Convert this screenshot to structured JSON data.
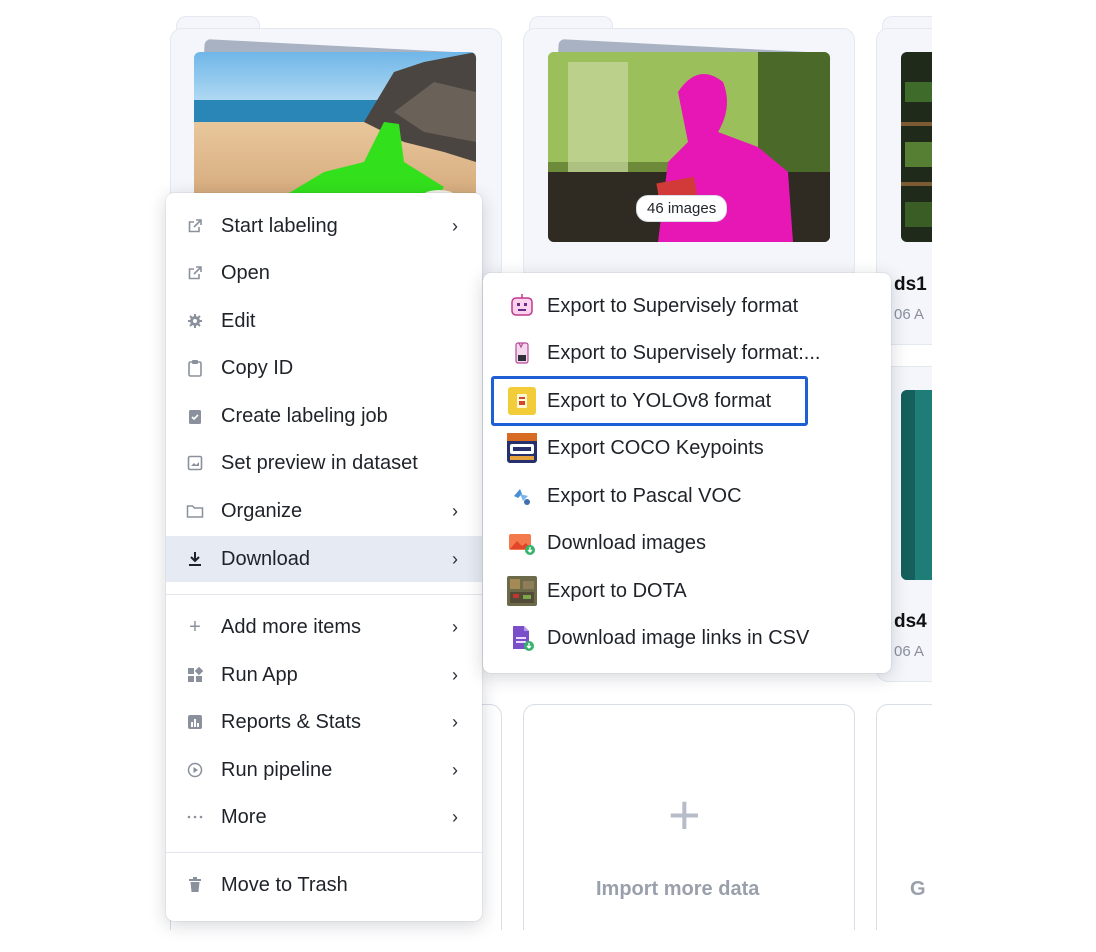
{
  "cards": {
    "card1_badge": "46 images",
    "ds1_name": "ds1",
    "ds1_date": "06 A",
    "ds4_name": "ds4",
    "ds4_date": "06 A",
    "import_label": "Import more data",
    "partial_label": "G"
  },
  "menu": {
    "items": [
      {
        "label": "Start labeling",
        "icon": "external-link-icon",
        "has_submenu": true
      },
      {
        "label": "Open",
        "icon": "external-link-icon",
        "has_submenu": false
      },
      {
        "label": "Edit",
        "icon": "gear-icon",
        "has_submenu": false
      },
      {
        "label": "Copy ID",
        "icon": "clipboard-icon",
        "has_submenu": false
      },
      {
        "label": "Create labeling job",
        "icon": "clipboard-check-icon",
        "has_submenu": false
      },
      {
        "label": "Set preview in dataset",
        "icon": "image-icon",
        "has_submenu": false
      },
      {
        "label": "Organize",
        "icon": "folder-icon",
        "has_submenu": true
      },
      {
        "label": "Download",
        "icon": "download-icon",
        "has_submenu": true,
        "active": true
      },
      {
        "label": "Add more items",
        "icon": "plus-icon",
        "has_submenu": true
      },
      {
        "label": "Run App",
        "icon": "apps-icon",
        "has_submenu": true
      },
      {
        "label": "Reports & Stats",
        "icon": "chart-icon",
        "has_submenu": true
      },
      {
        "label": "Run pipeline",
        "icon": "play-circle-icon",
        "has_submenu": true
      },
      {
        "label": "More",
        "icon": "ellipsis-icon",
        "has_submenu": true
      },
      {
        "label": "Move to Trash",
        "icon": "trash-icon",
        "has_submenu": false
      }
    ],
    "chevron": "›"
  },
  "submenu": {
    "items": [
      {
        "label": "Export to Supervisely format",
        "icon": "supervisely-export-icon"
      },
      {
        "label": "Export to Supervisely format:...",
        "icon": "supervisely-file-icon"
      },
      {
        "label": "Export to YOLOv8 format",
        "icon": "yolo-export-icon",
        "highlighted": true
      },
      {
        "label": "Export COCO Keypoints",
        "icon": "coco-keypoints-icon"
      },
      {
        "label": "Export to Pascal VOC",
        "icon": "pascal-voc-icon"
      },
      {
        "label": "Download images",
        "icon": "download-images-icon"
      },
      {
        "label": "Export to DOTA",
        "icon": "dota-icon"
      },
      {
        "label": "Download image links in CSV",
        "icon": "csv-file-icon"
      }
    ]
  },
  "colors": {
    "highlight_border": "#1e5fd6",
    "active_row": "#e6eaf2"
  }
}
